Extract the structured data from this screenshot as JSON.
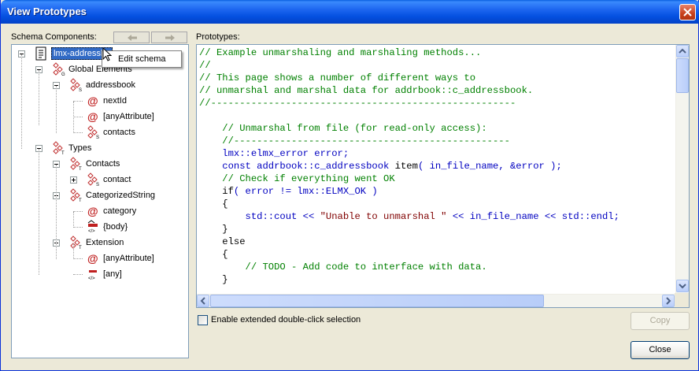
{
  "window": {
    "title": "View Prototypes",
    "close_icon": "close-icon"
  },
  "left": {
    "label": "Schema Components:",
    "back_icon": "arrow-left-icon",
    "forward_icon": "arrow-right-icon",
    "tree": [
      {
        "label": "lmx-addressbo",
        "level": 0,
        "icon": "schema-icon",
        "selected": true
      },
      {
        "label": "Global Elements",
        "level": 1,
        "icon": "global-elements-icon"
      },
      {
        "label": "addressbook",
        "level": 2,
        "icon": "element-icon"
      },
      {
        "label": "nextId",
        "level": 3,
        "icon": "attribute-icon"
      },
      {
        "label": "[anyAttribute]",
        "level": 3,
        "icon": "attribute-icon"
      },
      {
        "label": "contacts",
        "level": 3,
        "icon": "element-icon"
      },
      {
        "label": "Types",
        "level": 1,
        "icon": "types-icon"
      },
      {
        "label": "Contacts",
        "level": 2,
        "icon": "type-icon"
      },
      {
        "label": "contact",
        "level": 3,
        "icon": "element-icon",
        "collapsed": true
      },
      {
        "label": "CategorizedString",
        "level": 2,
        "icon": "type-icon"
      },
      {
        "label": "category",
        "level": 3,
        "icon": "attribute-icon"
      },
      {
        "label": "{body}",
        "level": 3,
        "icon": "body-icon"
      },
      {
        "label": "Extension",
        "level": 2,
        "icon": "type-icon"
      },
      {
        "label": "[anyAttribute]",
        "level": 3,
        "icon": "attribute-icon"
      },
      {
        "label": "[any]",
        "level": 3,
        "icon": "any-icon"
      }
    ],
    "context_menu": {
      "item": "Edit schema"
    }
  },
  "right": {
    "label": "Prototypes:",
    "code_lines": [
      {
        "parts": [
          [
            "c",
            "// Example unmarshaling and marshaling methods..."
          ]
        ]
      },
      {
        "parts": [
          [
            "c",
            "//"
          ]
        ]
      },
      {
        "parts": [
          [
            "c",
            "// This page shows a number of different ways to"
          ]
        ]
      },
      {
        "parts": [
          [
            "c",
            "// unmarshal and marshal data for addrbook::c_addressbook."
          ]
        ]
      },
      {
        "parts": [
          [
            "c",
            "//-----------------------------------------------------"
          ]
        ]
      },
      {
        "parts": []
      },
      {
        "parts": [
          [
            "c",
            "    // Unmarshal from file (for read-only access):"
          ]
        ]
      },
      {
        "parts": [
          [
            "c",
            "    //------------------------------------------------"
          ]
        ]
      },
      {
        "parts": [
          [
            "k",
            "    lmx::elmx_error error;"
          ]
        ]
      },
      {
        "parts": [
          [
            "k",
            "    const addrbook::c_addressbook "
          ],
          [
            "p",
            "item"
          ],
          [
            "k",
            "( in_file_name, &error );"
          ]
        ]
      },
      {
        "parts": [
          [
            "c",
            "    // Check if everything went OK"
          ]
        ]
      },
      {
        "parts": [
          [
            "p",
            "    if"
          ],
          [
            "k",
            "( error != lmx::ELMX_OK )"
          ]
        ]
      },
      {
        "parts": [
          [
            "p",
            "    {"
          ]
        ]
      },
      {
        "parts": [
          [
            "k",
            "        std::cout << "
          ],
          [
            "s",
            "\"Unable to unmarshal \""
          ],
          [
            "k",
            " << in_file_name << std::endl;"
          ]
        ]
      },
      {
        "parts": [
          [
            "p",
            "    }"
          ]
        ]
      },
      {
        "parts": [
          [
            "p",
            "    else"
          ]
        ]
      },
      {
        "parts": [
          [
            "p",
            "    {"
          ]
        ]
      },
      {
        "parts": [
          [
            "c",
            "        // TODO - Add code to interface with data."
          ]
        ]
      },
      {
        "parts": [
          [
            "p",
            "    }"
          ]
        ]
      }
    ]
  },
  "footer": {
    "checkbox_label": "Enable extended double-click selection",
    "checkbox_checked": false,
    "copy_label": "Copy",
    "close_label": "Close"
  }
}
